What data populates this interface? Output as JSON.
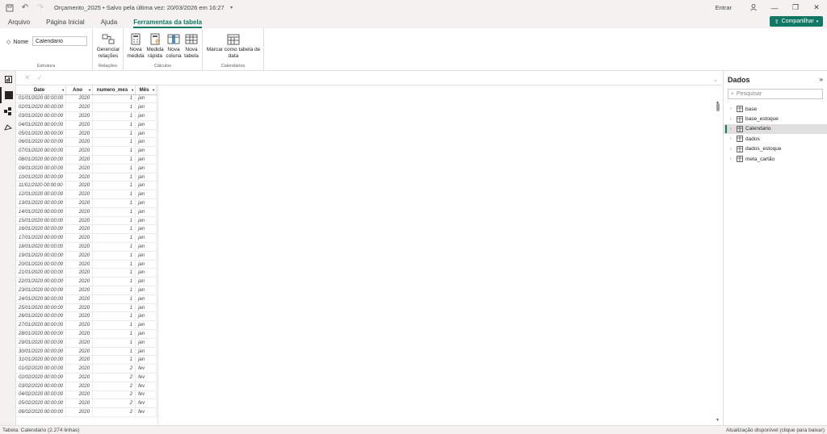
{
  "titlebar": {
    "doc_title": "Orçamento_2025 • Salvo pela última vez: 20/03/2026 em 16:27",
    "sign_in": "Entrar"
  },
  "menu": {
    "tabs": [
      "Arquivo",
      "Página Inicial",
      "Ajuda",
      "Ferramentas da tabela"
    ],
    "active_index": 3,
    "share_label": "Compartilhar"
  },
  "ribbon": {
    "name_label": "Nome",
    "name_value": "Calendario",
    "groups": {
      "estrutura": "Estrutura",
      "relacoes": "Relações",
      "calculos": "Cálculos",
      "calendarios": "Calendários"
    },
    "buttons": {
      "manage_relations": "Gerenciar relações",
      "new_measure": "Nova medida",
      "quick_measure": "Medida rápida",
      "new_column": "Nova coluna",
      "new_table": "Nova tabela",
      "mark_date_table": "Marcar como tabela de data"
    }
  },
  "grid": {
    "columns": [
      "Date",
      "Ano",
      "numero_mes",
      "Mês"
    ],
    "rows": [
      [
        "01/01/2020 00:00:00",
        "2020",
        "1",
        "jan"
      ],
      [
        "02/01/2020 00:00:00",
        "2020",
        "1",
        "jan"
      ],
      [
        "03/01/2020 00:00:00",
        "2020",
        "1",
        "jan"
      ],
      [
        "04/01/2020 00:00:00",
        "2020",
        "1",
        "jan"
      ],
      [
        "05/01/2020 00:00:00",
        "2020",
        "1",
        "jan"
      ],
      [
        "06/01/2020 00:00:00",
        "2020",
        "1",
        "jan"
      ],
      [
        "07/01/2020 00:00:00",
        "2020",
        "1",
        "jan"
      ],
      [
        "08/01/2020 00:00:00",
        "2020",
        "1",
        "jan"
      ],
      [
        "09/01/2020 00:00:00",
        "2020",
        "1",
        "jan"
      ],
      [
        "10/01/2020 00:00:00",
        "2020",
        "1",
        "jan"
      ],
      [
        "11/01/2020 00:00:00",
        "2020",
        "1",
        "jan"
      ],
      [
        "12/01/2020 00:00:00",
        "2020",
        "1",
        "jan"
      ],
      [
        "13/01/2020 00:00:00",
        "2020",
        "1",
        "jan"
      ],
      [
        "14/01/2020 00:00:00",
        "2020",
        "1",
        "jan"
      ],
      [
        "15/01/2020 00:00:00",
        "2020",
        "1",
        "jan"
      ],
      [
        "16/01/2020 00:00:00",
        "2020",
        "1",
        "jan"
      ],
      [
        "17/01/2020 00:00:00",
        "2020",
        "1",
        "jan"
      ],
      [
        "18/01/2020 00:00:00",
        "2020",
        "1",
        "jan"
      ],
      [
        "19/01/2020 00:00:00",
        "2020",
        "1",
        "jan"
      ],
      [
        "20/01/2020 00:00:00",
        "2020",
        "1",
        "jan"
      ],
      [
        "21/01/2020 00:00:00",
        "2020",
        "1",
        "jan"
      ],
      [
        "22/01/2020 00:00:00",
        "2020",
        "1",
        "jan"
      ],
      [
        "23/01/2020 00:00:00",
        "2020",
        "1",
        "jan"
      ],
      [
        "24/01/2020 00:00:00",
        "2020",
        "1",
        "jan"
      ],
      [
        "25/01/2020 00:00:00",
        "2020",
        "1",
        "jan"
      ],
      [
        "26/01/2020 00:00:00",
        "2020",
        "1",
        "jan"
      ],
      [
        "27/01/2020 00:00:00",
        "2020",
        "1",
        "jan"
      ],
      [
        "28/01/2020 00:00:00",
        "2020",
        "1",
        "jan"
      ],
      [
        "29/01/2020 00:00:00",
        "2020",
        "1",
        "jan"
      ],
      [
        "30/01/2020 00:00:00",
        "2020",
        "1",
        "jan"
      ],
      [
        "31/01/2020 00:00:00",
        "2020",
        "1",
        "jan"
      ],
      [
        "01/02/2020 00:00:00",
        "2020",
        "2",
        "fev"
      ],
      [
        "02/02/2020 00:00:00",
        "2020",
        "2",
        "fev"
      ],
      [
        "03/02/2020 00:00:00",
        "2020",
        "2",
        "fev"
      ],
      [
        "04/02/2020 00:00:00",
        "2020",
        "2",
        "fev"
      ],
      [
        "05/02/2020 00:00:00",
        "2020",
        "2",
        "fev"
      ],
      [
        "06/02/2020 00:00:00",
        "2020",
        "2",
        "fev"
      ]
    ]
  },
  "data_pane": {
    "title": "Dados",
    "search_placeholder": "Pesquisar",
    "tables": [
      "base",
      "base_estoque",
      "Calendario",
      "dados",
      "dados_estoque",
      "meta_cartão"
    ],
    "selected_index": 2
  },
  "status": {
    "left": "Tabela: Calendario (2.274 linhas)",
    "right": "Atualização disponível (clique para baixar)"
  },
  "colors": {
    "accent": "#117865",
    "chrome": "#f3f2f1",
    "border": "#e1dfdd"
  }
}
